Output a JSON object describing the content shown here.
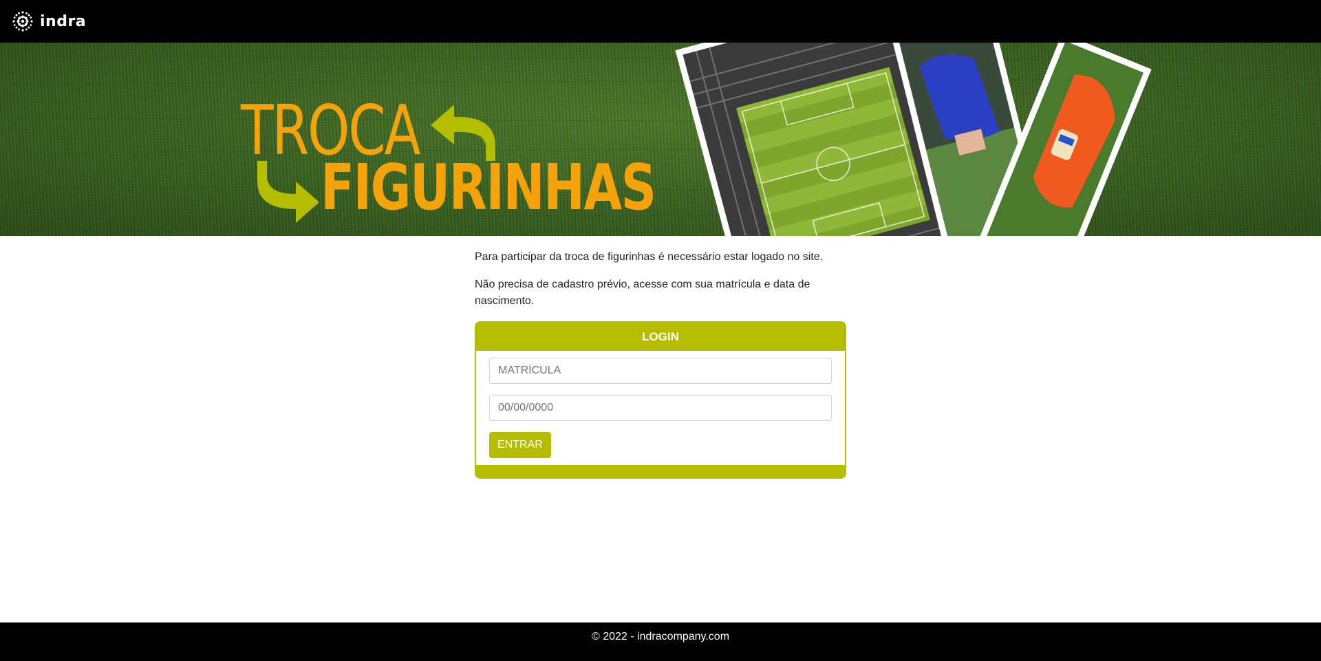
{
  "navbar": {
    "brand_name": "indra"
  },
  "hero": {
    "title_line1": "TROCA",
    "title_line2": "FIGURINHAS",
    "accent_orange": "#f4a30b",
    "accent_green": "#b4bd00"
  },
  "intro": {
    "paragraph1": "Para participar da troca de figurinhas é necessário estar logado no site.",
    "paragraph2": "Não precisa de cadastro prévio, acesse com sua matrícula e data de nascimento."
  },
  "login": {
    "header": "LOGIN",
    "matricula_placeholder": "MATRÍCULA",
    "matricula_value": "",
    "birthdate_placeholder": "00/00/0000",
    "birthdate_value": "",
    "submit_label": "ENTRAR"
  },
  "footer": {
    "text": "© 2022 - indracompany.com"
  }
}
